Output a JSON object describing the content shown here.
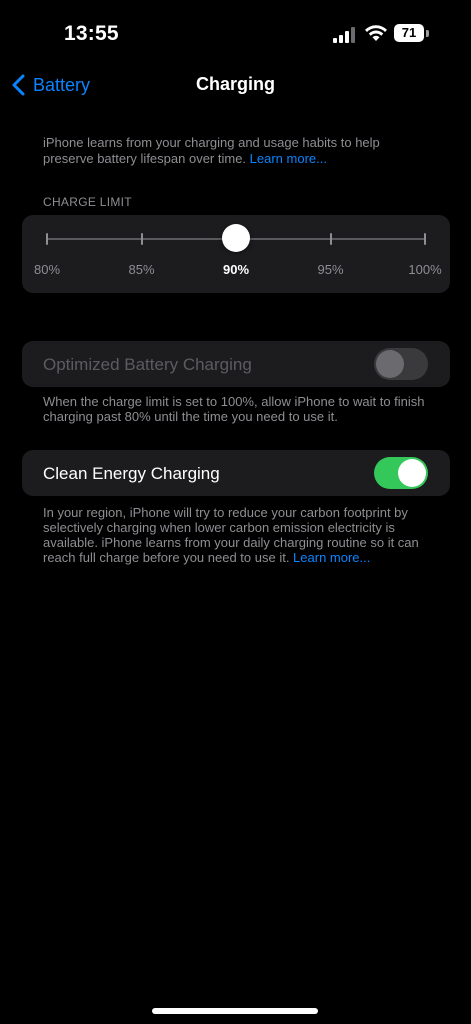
{
  "status_bar": {
    "time": "13:55",
    "battery_percent": "71",
    "icons": [
      "cellular-signal-icon",
      "wifi-icon",
      "battery-icon"
    ]
  },
  "nav": {
    "back_label": "Battery",
    "title": "Charging"
  },
  "intro": {
    "text": "iPhone learns from your charging and usage habits to help preserve battery lifespan over time. ",
    "link": "Learn more..."
  },
  "charge_limit": {
    "header": "CHARGE LIMIT",
    "options": [
      "80%",
      "85%",
      "90%",
      "95%",
      "100%"
    ],
    "selected_index": 2,
    "selected_value": "90%"
  },
  "optimized_charging": {
    "label": "Optimized Battery Charging",
    "enabled": false,
    "disabled": true,
    "footer": "When the charge limit is set to 100%, allow iPhone to wait to finish charging past 80% until the time you need to use it."
  },
  "clean_energy": {
    "label": "Clean Energy Charging",
    "enabled": true,
    "footer": "In your region, iPhone will try to reduce your carbon footprint by selectively charging when lower carbon emission electricity is available. iPhone learns from your daily charging routine so it can reach full charge before you need to use it. ",
    "link": "Learn more..."
  },
  "colors": {
    "accent": "#0a84ff",
    "toggle_on": "#34c759",
    "background": "#000000",
    "card": "#1c1c1e",
    "secondary_text": "#8e8e93"
  }
}
